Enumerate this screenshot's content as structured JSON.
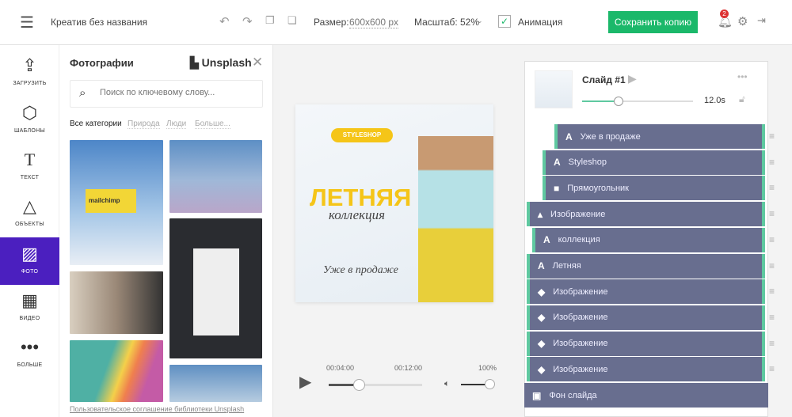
{
  "header": {
    "title": "Креатив без названия",
    "size_label": "Размер:",
    "size_value": "600x600 px",
    "zoom_label": "Масштаб: 52%",
    "animation_label": "Анимация",
    "animation_checked": true,
    "save_label": "Сохранить копию",
    "notification_count": "2"
  },
  "rail": [
    {
      "icon": "upload-icon",
      "label": "ЗАГРУЗИТЬ"
    },
    {
      "icon": "templates-icon",
      "label": "ШАБЛОНЫ"
    },
    {
      "icon": "text-icon",
      "label": "ТЕКСТ"
    },
    {
      "icon": "objects-icon",
      "label": "ОБЪЕКТЫ"
    },
    {
      "icon": "photo-icon",
      "label": "ФОТО",
      "active": true
    },
    {
      "icon": "video-icon",
      "label": "ВИДЕО"
    },
    {
      "icon": "more-icon",
      "label": "БОЛЬШЕ"
    }
  ],
  "panel": {
    "title": "Фотографии",
    "brand": "Unsplash",
    "search_placeholder": "Поиск по ключевому слову...",
    "categories": [
      "Все категории",
      "Природа",
      "Люди",
      "Больше..."
    ],
    "footer": "Пользовательское соглашение библиотеки Unsplash"
  },
  "canvas": {
    "badge": "STYLESHOP",
    "headline": "ЛЕТНЯЯ",
    "sub": "коллекция",
    "tagline": "Уже в продаже"
  },
  "player": {
    "current": "00:04:00",
    "total": "00:12:00",
    "volume": "100%",
    "progress": 0.33,
    "volume_level": 1.0
  },
  "slide": {
    "title": "Слайд #1",
    "duration": "12.0s",
    "duration_fraction": 0.33
  },
  "layers": [
    {
      "icon": "A",
      "label": "Уже в продаже"
    },
    {
      "icon": "A",
      "label": "Styleshop"
    },
    {
      "icon": "■",
      "label": "Прямоугольник"
    },
    {
      "icon": "▴",
      "label": "Изображение"
    },
    {
      "icon": "A",
      "label": "коллекция"
    },
    {
      "icon": "A",
      "label": "Летняя"
    },
    {
      "icon": "◆",
      "label": "Изображение"
    },
    {
      "icon": "◆",
      "label": "Изображение"
    },
    {
      "icon": "◆",
      "label": "Изображение"
    },
    {
      "icon": "◆",
      "label": "Изображение"
    },
    {
      "icon": "▣",
      "label": "Фон слайда"
    }
  ],
  "colors": {
    "accent": "#1bb86a",
    "rail_active": "#4b1fbf",
    "layer_bg": "#686e8f",
    "layer_edge": "#5fc9a0",
    "brand_yellow": "#f5c518"
  }
}
